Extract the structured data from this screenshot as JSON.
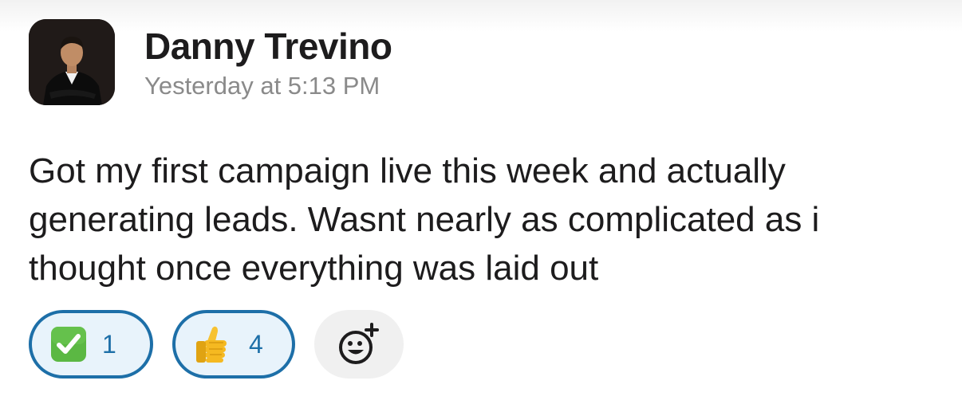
{
  "message": {
    "author": "Danny Trevino",
    "timestamp": "Yesterday at 5:13 PM",
    "text": "Got my first campaign live this week and actually generating leads. Wasnt nearly as complicated as i thought once everything was laid out"
  },
  "reactions": [
    {
      "icon": "white-check-mark-icon",
      "count": "1",
      "selected": true
    },
    {
      "icon": "thumbs-up-icon",
      "count": "4",
      "selected": true
    }
  ],
  "add_reaction": {
    "icon": "add-reaction-icon"
  },
  "colors": {
    "selected_border": "#1d6fa8",
    "selected_background": "#e8f3fb",
    "check_green": "#5bb843",
    "timestamp_gray": "#8a8a8a"
  }
}
